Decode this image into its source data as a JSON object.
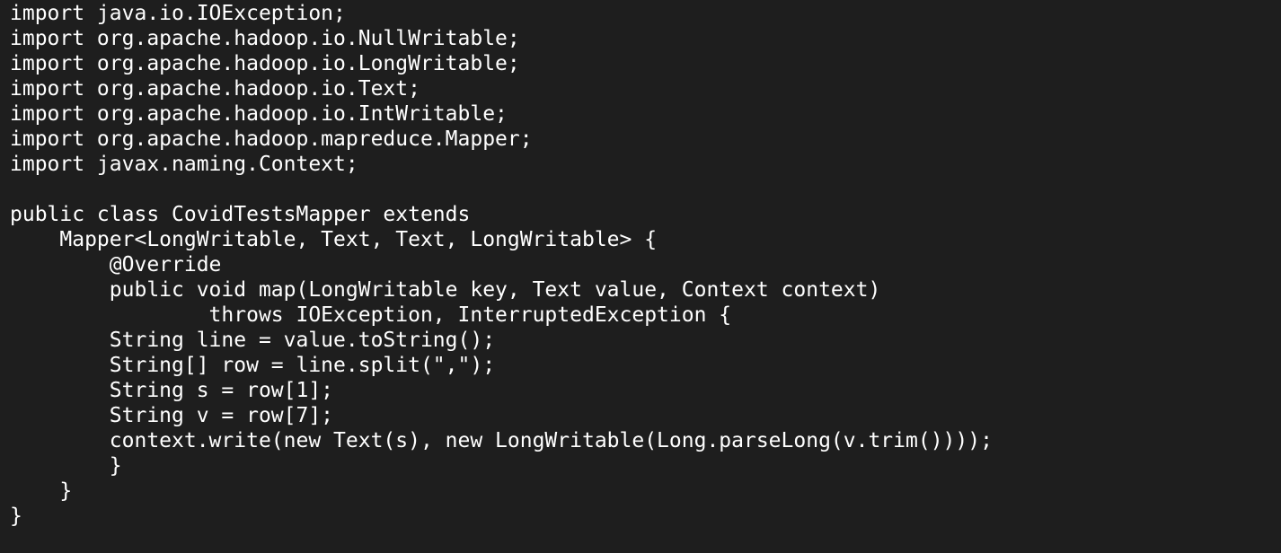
{
  "editor": {
    "background": "#1e1e1e",
    "text_color": "#ffffff",
    "lines": [
      "import java.io.IOException;",
      "import org.apache.hadoop.io.NullWritable;",
      "import org.apache.hadoop.io.LongWritable;",
      "import org.apache.hadoop.io.Text;",
      "import org.apache.hadoop.io.IntWritable;",
      "import org.apache.hadoop.mapreduce.Mapper;",
      "import javax.naming.Context;",
      "",
      "public class CovidTestsMapper extends",
      "    Mapper<LongWritable, Text, Text, LongWritable> {",
      "        @Override",
      "        public void map(LongWritable key, Text value, Context context)",
      "                throws IOException, InterruptedException {",
      "        String line = value.toString();",
      "        String[] row = line.split(\",\");",
      "        String s = row[1];",
      "        String v = row[7];",
      "        context.write(new Text(s), new LongWritable(Long.parseLong(v.trim())));",
      "        }",
      "    }",
      "}"
    ]
  }
}
